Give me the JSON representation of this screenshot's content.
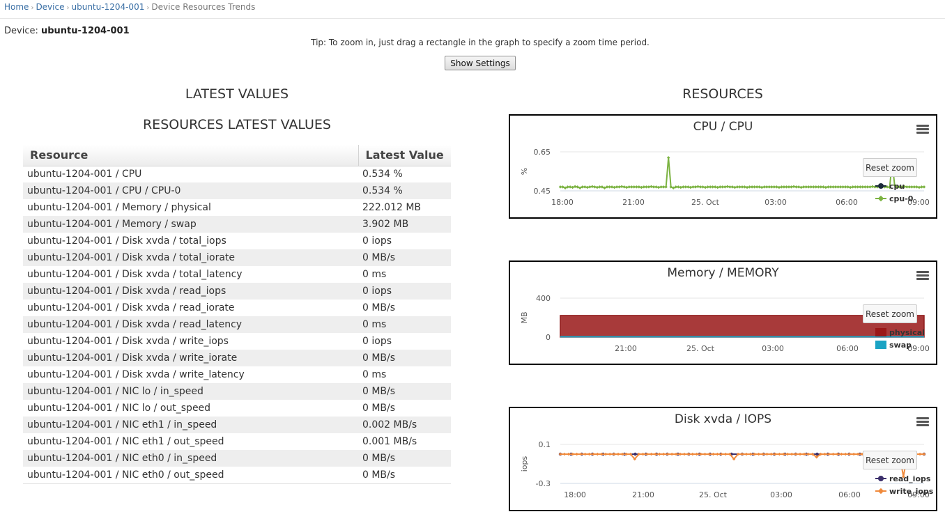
{
  "breadcrumb": {
    "home": "Home",
    "device": "Device",
    "device_name": "ubuntu-1204-001",
    "current": "Device Resources Trends",
    "separator": "›"
  },
  "device": {
    "label": "Device:",
    "name": "ubuntu-1204-001"
  },
  "tip": "Tip: To zoom in, just drag a rectangle in the graph to specify a zoom time period.",
  "settings_button": "Show Settings",
  "latest_values_title": "LATEST VALUES",
  "resources_latest_values_title": "RESOURCES LATEST VALUES",
  "resources_title": "RESOURCES",
  "table": {
    "headers": {
      "resource": "Resource",
      "value": "Latest Value"
    },
    "rows": [
      {
        "resource": "ubuntu-1204-001 / CPU",
        "value": "0.534 %"
      },
      {
        "resource": "ubuntu-1204-001 / CPU / CPU-0",
        "value": "0.534 %"
      },
      {
        "resource": "ubuntu-1204-001 / Memory / physical",
        "value": "222.012 MB"
      },
      {
        "resource": "ubuntu-1204-001 / Memory / swap",
        "value": "3.902 MB"
      },
      {
        "resource": "ubuntu-1204-001 / Disk xvda / total_iops",
        "value": "0 iops"
      },
      {
        "resource": "ubuntu-1204-001 / Disk xvda / total_iorate",
        "value": "0 MB/s"
      },
      {
        "resource": "ubuntu-1204-001 / Disk xvda / total_latency",
        "value": "0 ms"
      },
      {
        "resource": "ubuntu-1204-001 / Disk xvda / read_iops",
        "value": "0 iops"
      },
      {
        "resource": "ubuntu-1204-001 / Disk xvda / read_iorate",
        "value": "0 MB/s"
      },
      {
        "resource": "ubuntu-1204-001 / Disk xvda / read_latency",
        "value": "0 ms"
      },
      {
        "resource": "ubuntu-1204-001 / Disk xvda / write_iops",
        "value": "0 iops"
      },
      {
        "resource": "ubuntu-1204-001 / Disk xvda / write_iorate",
        "value": "0 MB/s"
      },
      {
        "resource": "ubuntu-1204-001 / Disk xvda / write_latency",
        "value": "0 ms"
      },
      {
        "resource": "ubuntu-1204-001 / NIC lo / in_speed",
        "value": "0 MB/s"
      },
      {
        "resource": "ubuntu-1204-001 / NIC lo / out_speed",
        "value": "0 MB/s"
      },
      {
        "resource": "ubuntu-1204-001 / NIC eth1 / in_speed",
        "value": "0.002 MB/s"
      },
      {
        "resource": "ubuntu-1204-001 / NIC eth1 / out_speed",
        "value": "0.001 MB/s"
      },
      {
        "resource": "ubuntu-1204-001 / NIC eth0 / in_speed",
        "value": "0 MB/s"
      },
      {
        "resource": "ubuntu-1204-001 / NIC eth0 / out_speed",
        "value": "0 MB/s"
      }
    ]
  },
  "reset_zoom_label": "Reset zoom",
  "menu_icon": "hamburger-menu-icon",
  "chart_data": [
    {
      "type": "line",
      "title": "CPU / CPU",
      "ylabel": "%",
      "ylim": [
        0.45,
        0.65
      ],
      "yticks": [
        "0.65",
        "0.45"
      ],
      "xticks": [
        "18:00",
        "21:00",
        "25. Oct",
        "03:00",
        "06:00",
        "09:00"
      ],
      "xlim": [
        0,
        15
      ],
      "series": [
        {
          "name": "cpu",
          "color": "#1b2a3a",
          "marker": "circle",
          "y": []
        },
        {
          "name": "cpu-0",
          "color": "#7cb342",
          "marker": "diamond",
          "y": [
            0.47,
            0.47,
            0.465,
            0.47,
            0.47,
            0.468,
            0.472,
            0.47,
            0.465,
            0.47,
            0.47,
            0.468,
            0.47,
            0.472,
            0.47,
            0.468,
            0.47,
            0.47,
            0.465,
            0.47,
            0.47,
            0.47,
            0.468,
            0.47,
            0.47,
            0.472,
            0.47,
            0.468,
            0.47,
            0.47,
            0.47,
            0.47,
            0.47,
            0.468,
            0.47,
            0.47,
            0.47,
            0.472,
            0.47,
            0.47,
            0.468,
            0.47,
            0.47,
            0.47,
            0.62,
            0.47,
            0.465,
            0.47,
            0.47,
            0.468,
            0.47,
            0.47,
            0.47,
            0.468,
            0.47,
            0.47,
            0.472,
            0.47,
            0.47,
            0.468,
            0.47,
            0.47,
            0.47,
            0.47,
            0.468,
            0.47,
            0.47,
            0.47,
            0.472,
            0.47,
            0.47,
            0.468,
            0.47,
            0.47,
            0.47,
            0.47,
            0.468,
            0.47,
            0.47,
            0.47,
            0.47,
            0.47,
            0.468,
            0.47,
            0.47,
            0.47,
            0.47,
            0.47,
            0.47,
            0.468,
            0.47,
            0.47,
            0.47,
            0.47,
            0.47,
            0.472,
            0.47,
            0.47,
            0.468,
            0.47,
            0.47,
            0.47,
            0.47,
            0.47,
            0.47,
            0.47,
            0.47,
            0.47,
            0.468,
            0.47,
            0.47,
            0.47,
            0.47,
            0.47,
            0.47,
            0.47,
            0.47,
            0.47,
            0.468,
            0.47,
            0.47,
            0.47,
            0.47,
            0.47,
            0.47,
            0.47,
            0.47,
            0.472,
            0.47,
            0.47,
            0.47,
            0.47,
            0.47,
            0.47,
            0.468,
            0.6,
            0.48,
            0.47,
            0.47,
            0.47,
            0.472,
            0.47,
            0.47,
            0.47,
            0.47,
            0.47,
            0.468,
            0.47,
            0.47
          ]
        }
      ]
    },
    {
      "type": "area",
      "title": "Memory / MEMORY",
      "ylabel": "MB",
      "ylim": [
        0,
        400
      ],
      "yticks": [
        "400",
        "0"
      ],
      "xticks": [
        "21:00",
        "25. Oct",
        "03:00",
        "06:00",
        "09:00"
      ],
      "xlim": [
        0,
        15
      ],
      "series": [
        {
          "name": "physical",
          "color": "#b03a3a",
          "value": 222.012
        },
        {
          "name": "swap",
          "color": "#1aa3c4",
          "value": 3.902
        }
      ]
    },
    {
      "type": "line",
      "title": "Disk xvda / IOPS",
      "ylabel": "iops",
      "ylim": [
        -0.3,
        0.1
      ],
      "yticks": [
        "0.1",
        "-0.3"
      ],
      "xticks": [
        "18:00",
        "21:00",
        "25. Oct",
        "03:00",
        "06:00",
        "09:00"
      ],
      "xlim": [
        0,
        15
      ],
      "series": [
        {
          "name": "read_iops",
          "color": "#3b2f6b",
          "marker": "circle",
          "y": [
            0,
            0,
            0,
            0,
            0,
            0,
            0,
            0,
            0,
            0,
            0,
            0,
            0,
            0,
            0,
            0,
            0,
            0,
            0,
            0,
            0,
            0,
            0,
            0,
            0,
            0,
            0,
            0,
            0,
            0,
            0,
            0,
            0,
            0,
            0
          ]
        },
        {
          "name": "write_iops",
          "color": "#f08a3c",
          "marker": "diamond",
          "y": [
            0,
            0,
            0,
            0,
            0,
            0,
            0,
            0,
            0,
            0,
            0,
            0,
            0,
            0,
            0,
            0,
            0,
            0,
            -0.05,
            0,
            0,
            0,
            0,
            0,
            0,
            0,
            0,
            0,
            0,
            0,
            0,
            0,
            0,
            0,
            0,
            0,
            0,
            0,
            0,
            0,
            0,
            0,
            -0.05,
            0,
            0,
            0,
            0,
            0,
            0,
            0,
            0,
            0,
            0,
            0,
            0,
            0,
            0,
            0,
            0,
            0,
            0,
            0,
            -0.03,
            0,
            0,
            0,
            0,
            0,
            0,
            0,
            0,
            0,
            0,
            0,
            0,
            0,
            0,
            0,
            0,
            0,
            0,
            0,
            0,
            -0.23,
            0,
            0,
            0,
            0,
            0
          ]
        }
      ]
    }
  ]
}
